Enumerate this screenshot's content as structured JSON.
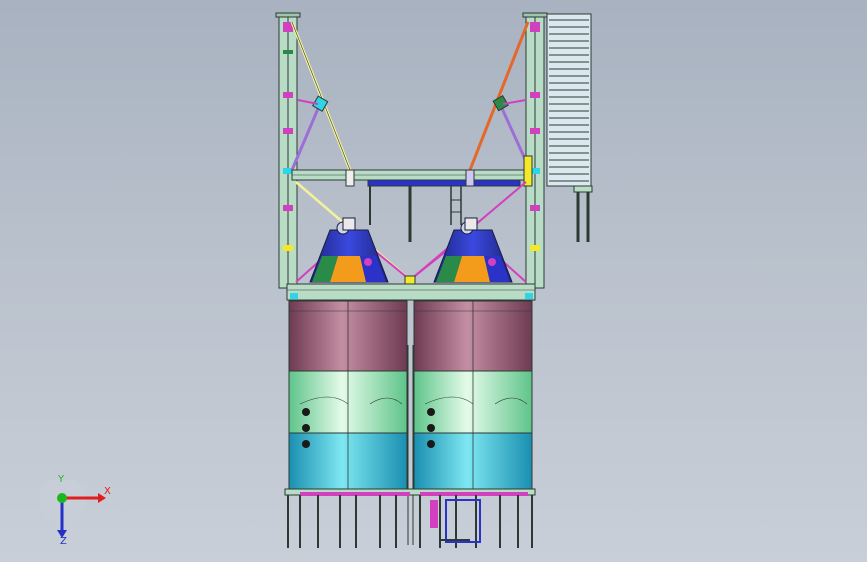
{
  "viewport": {
    "background_top": "#a8b2c0",
    "background_bottom": "#c9cfd8"
  },
  "model": {
    "description_icon": "cad-3d-model",
    "colors": {
      "frame": "#b9dcc6",
      "frame_edge": "#2b3a33",
      "tank_top": "#a86b80",
      "tank_mid": "#a7efc4",
      "tank_bottom": "#3fc3d6",
      "cone_blue": "#2b32c8",
      "cone_orange": "#f39b1b",
      "cone_green": "#2a8a48",
      "brace_yellow": "#f3f19a",
      "brace_orange": "#e3682a",
      "stair": "#d7e6ee",
      "magenta": "#d23fbf"
    }
  },
  "triad": {
    "x_label": "X",
    "y_label": "Y",
    "z_label": "Z",
    "x_color": "#e11d1d",
    "y_color": "#19b81f",
    "z_color": "#2530c8"
  }
}
